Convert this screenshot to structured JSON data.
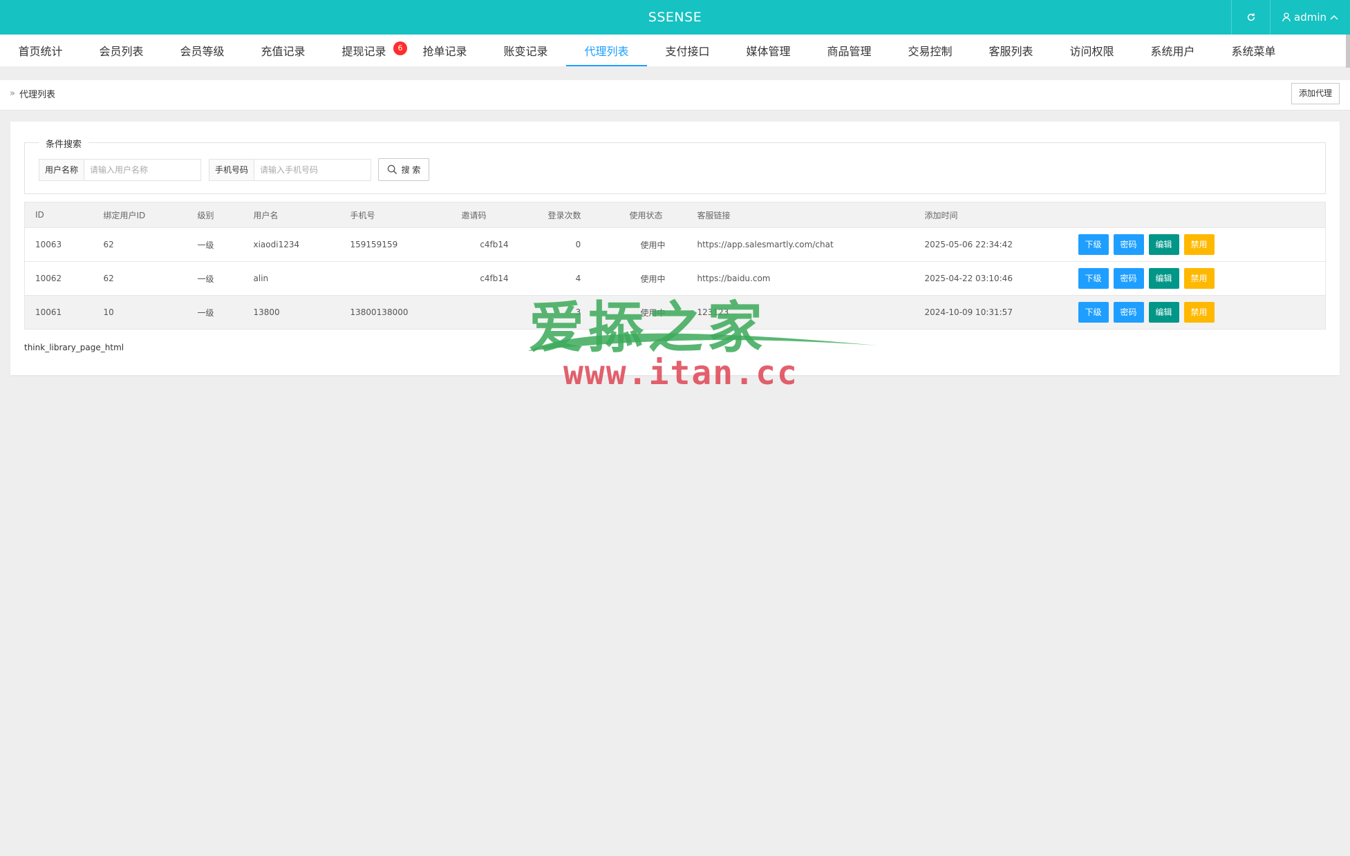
{
  "header": {
    "brand": "SSENSE",
    "user": "admin"
  },
  "nav": {
    "items": [
      {
        "label": "首页统计"
      },
      {
        "label": "会员列表"
      },
      {
        "label": "会员等级"
      },
      {
        "label": "充值记录"
      },
      {
        "label": "提现记录",
        "badge": "6"
      },
      {
        "label": "抢单记录"
      },
      {
        "label": "账变记录"
      },
      {
        "label": "代理列表",
        "active": true
      },
      {
        "label": "支付接口"
      },
      {
        "label": "媒体管理"
      },
      {
        "label": "商品管理"
      },
      {
        "label": "交易控制"
      },
      {
        "label": "客服列表"
      },
      {
        "label": "访问权限"
      },
      {
        "label": "系统用户"
      },
      {
        "label": "系统菜单"
      }
    ]
  },
  "breadcrumb": {
    "current": "代理列表",
    "add_button": "添加代理"
  },
  "search": {
    "legend": "条件搜索",
    "username_label": "用户名称",
    "username_placeholder": "请输入用户名称",
    "phone_label": "手机号码",
    "phone_placeholder": "请输入手机号码",
    "button": "搜 索"
  },
  "table": {
    "headers": [
      "ID",
      "绑定用户ID",
      "级别",
      "用户名",
      "手机号",
      "邀请码",
      "登录次数",
      "使用状态",
      "客服链接",
      "添加时间",
      ""
    ],
    "rows": [
      {
        "id": "10063",
        "bind_uid": "62",
        "level": "一级",
        "username": "xiaodi1234",
        "phone": "159159159",
        "invite": "c4fb14",
        "logins": "0",
        "status": "使用中",
        "link": "https://app.salesmartly.com/chat",
        "time": "2025-05-06 22:34:42"
      },
      {
        "id": "10062",
        "bind_uid": "62",
        "level": "一级",
        "username": "alin",
        "phone": "",
        "invite": "c4fb14",
        "logins": "4",
        "status": "使用中",
        "link": "https://baidu.com",
        "time": "2025-04-22 03:10:46"
      },
      {
        "id": "10061",
        "bind_uid": "10",
        "level": "一级",
        "username": "13800",
        "phone": "13800138000",
        "invite": "",
        "logins": "3",
        "status": "使用中",
        "link": "123123",
        "time": "2024-10-09 10:31:57"
      }
    ],
    "actions": {
      "sub": "下级",
      "password": "密码",
      "edit": "编辑",
      "disable": "禁用"
    }
  },
  "pagination_text": "think_library_page_html",
  "watermark": {
    "text": "爱掭之家",
    "url": "www.itan.cc"
  },
  "colors": {
    "topbar": "#16c2c2",
    "active": "#1e9fff",
    "blue_btn": "#1e9fff",
    "green_btn": "#009688",
    "orange_btn": "#ffb800",
    "status_green": "#15a515",
    "badge": "#ff2d2d"
  }
}
